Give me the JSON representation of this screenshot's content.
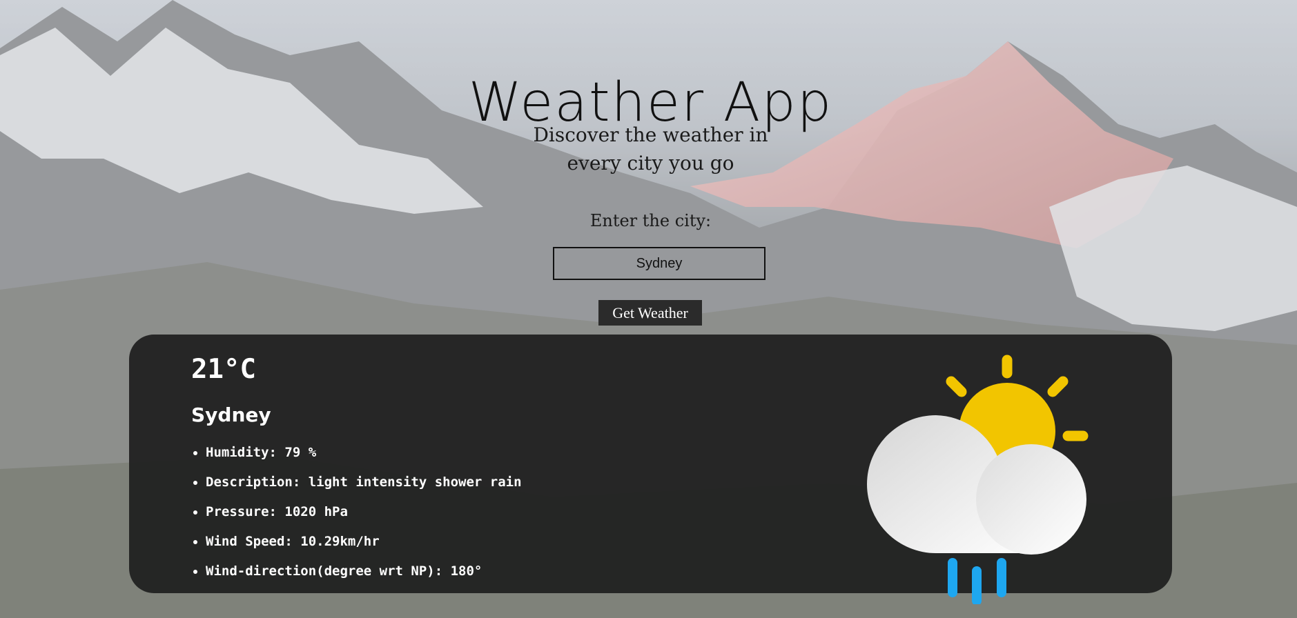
{
  "header": {
    "title": "Weather App",
    "subtitle_line1": "Discover the weather in",
    "subtitle_line2": "every city you go"
  },
  "form": {
    "label": "Enter the city:",
    "city_value": "Sydney",
    "button_label": "Get Weather"
  },
  "result": {
    "temperature": "21°C",
    "city": "Sydney",
    "humidity": "Humidity: 79 %",
    "description": "Description: light intensity shower rain",
    "pressure": "Pressure: 1020 hPa",
    "wind_speed": "Wind Speed: 10.29km/hr",
    "wind_direction": "Wind-direction(degree wrt NP): 180°",
    "icon": "partly-cloudy-rain-icon"
  },
  "colors": {
    "card_background": "#202020",
    "button_background": "#2b2b2b",
    "sun": "#f2c500",
    "rain": "#1ea7f0"
  }
}
